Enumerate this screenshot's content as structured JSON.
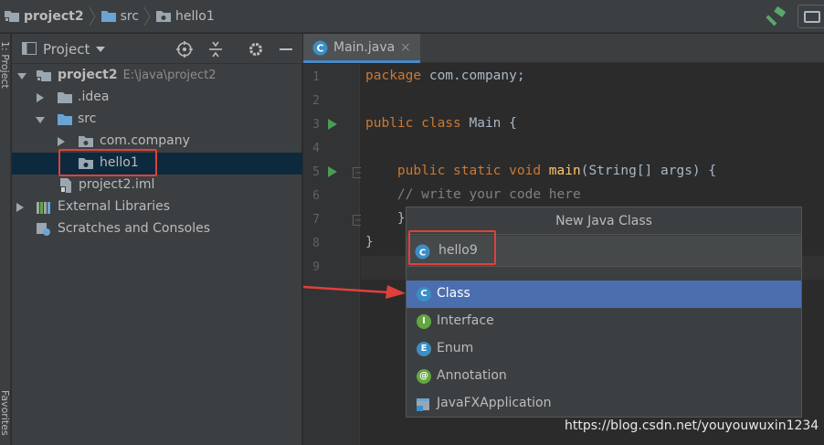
{
  "breadcrumb": {
    "items": [
      {
        "label": "project2",
        "icon": "folder-project-icon"
      },
      {
        "label": "src",
        "icon": "folder-icon"
      },
      {
        "label": "hello1",
        "icon": "package-icon"
      }
    ]
  },
  "toolbar": {
    "build_icon": "hammer-icon",
    "right_button_icon": "window-icon"
  },
  "side_strip": {
    "top_label": "1: Project",
    "bottom_label": "Favorites"
  },
  "project_panel": {
    "title": "Project",
    "tools": [
      "locate-icon",
      "collapse-icon",
      "settings-icon",
      "hide-icon"
    ],
    "tree": [
      {
        "label": "project2",
        "path": "E:\\java\\project2",
        "icon": "folder-project-icon",
        "expanded": true,
        "bold": true
      },
      {
        "label": ".idea",
        "icon": "folder-icon",
        "expanded": false
      },
      {
        "label": "src",
        "icon": "source-folder-icon",
        "expanded": true
      },
      {
        "label": "com.company",
        "icon": "package-icon",
        "expanded": false
      },
      {
        "label": "hello1",
        "icon": "package-icon",
        "selected": true
      },
      {
        "label": "project2.iml",
        "icon": "iml-file-icon"
      },
      {
        "label": "External Libraries",
        "icon": "libraries-icon",
        "expanded": false
      },
      {
        "label": "Scratches and Consoles",
        "icon": "scratches-icon"
      }
    ]
  },
  "editor": {
    "tab": {
      "label": "Main.java",
      "close": "×",
      "icon": "java-class-icon"
    },
    "line_numbers": [
      "1",
      "2",
      "3",
      "4",
      "5",
      "6",
      "7",
      "8",
      "9"
    ],
    "code": {
      "l1_kw": "package",
      "l1_rest": " com.company;",
      "l3_kw": "public class",
      "l3_rest": " Main {",
      "l5_kw": "public static void",
      "l5_fn": "main",
      "l5_rest": "(String[] args) {",
      "l6_comment": "// write your code here",
      "l7": "}",
      "l8": "}"
    }
  },
  "popup": {
    "title": "New Java Class",
    "input_value": "hello9",
    "items": [
      {
        "label": "Class",
        "icon": "class-icon",
        "letter": "C",
        "color": "#3b8ec6",
        "selected": true
      },
      {
        "label": "Interface",
        "icon": "interface-icon",
        "letter": "I",
        "color": "#62a73f"
      },
      {
        "label": "Enum",
        "icon": "enum-icon",
        "letter": "E",
        "color": "#3b8ec6"
      },
      {
        "label": "Annotation",
        "icon": "annotation-icon",
        "letter": "@",
        "color": "#62a73f"
      },
      {
        "label": "JavaFXApplication",
        "icon": "javafx-icon",
        "letter": "",
        "color": "#3b8ec6"
      }
    ]
  },
  "watermark": "https://blog.csdn.net/youyouwuxin1234",
  "colors": {
    "accent": "#4b6eaf",
    "annotation_red": "#e0403a",
    "selection": "#0d293e"
  }
}
